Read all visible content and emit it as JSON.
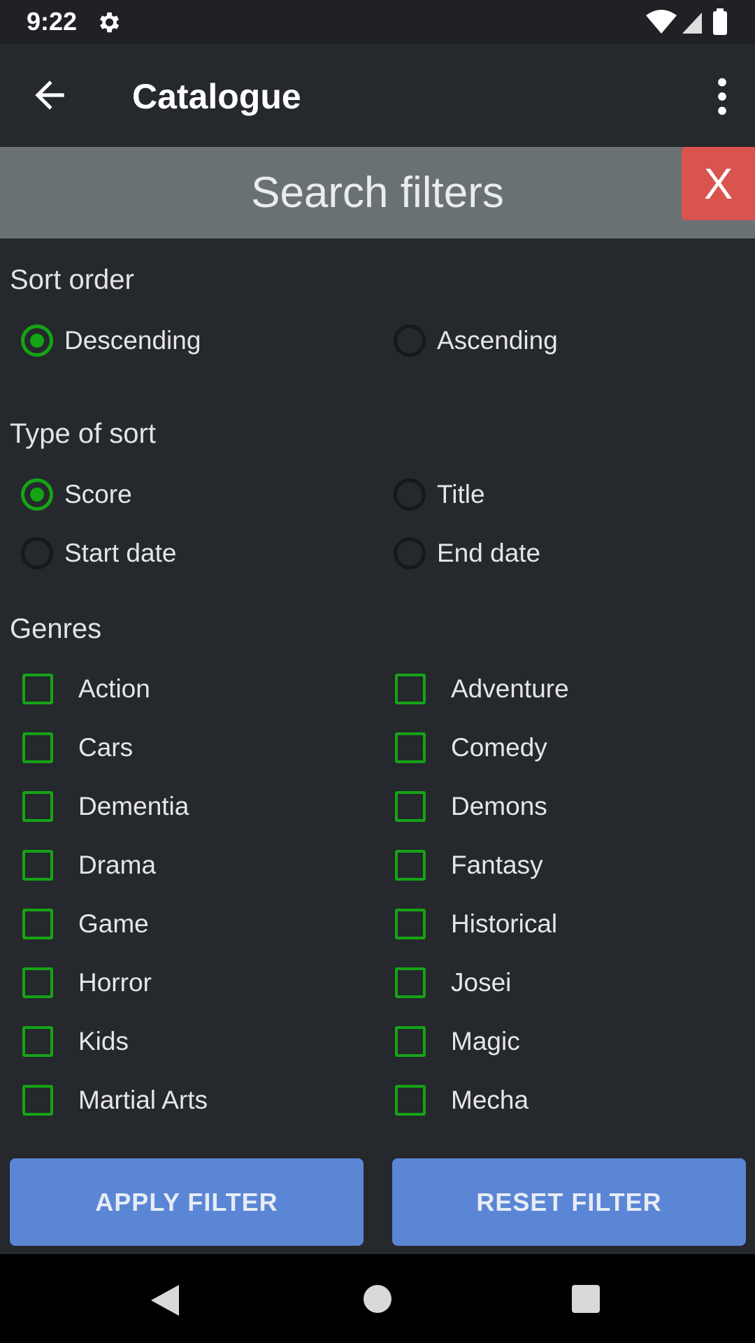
{
  "status_bar": {
    "time": "9:22"
  },
  "app_bar": {
    "title": "Catalogue"
  },
  "filter_panel": {
    "title": "Search filters",
    "close_label": "X",
    "sort_order": {
      "label": "Sort order",
      "options": [
        {
          "label": "Descending",
          "checked": true
        },
        {
          "label": "Ascending",
          "checked": false
        }
      ]
    },
    "sort_type": {
      "label": "Type of sort",
      "options": [
        {
          "label": "Score",
          "checked": true
        },
        {
          "label": "Title",
          "checked": false
        },
        {
          "label": "Start date",
          "checked": false
        },
        {
          "label": "End date",
          "checked": false
        }
      ]
    },
    "genres": {
      "label": "Genres",
      "items": [
        "Action",
        "Adventure",
        "Cars",
        "Comedy",
        "Dementia",
        "Demons",
        "Drama",
        "Fantasy",
        "Game",
        "Historical",
        "Horror",
        "Josei",
        "Kids",
        "Magic",
        "Martial Arts",
        "Mecha"
      ]
    },
    "buttons": {
      "apply": "APPLY FILTER",
      "reset": "RESET FILTER"
    }
  },
  "colors": {
    "accent_green": "#15a316",
    "button_blue": "#5b86d6",
    "close_red": "#d9534f"
  },
  "icons": {
    "back": "arrow-left-icon",
    "menu": "more-vert-icon",
    "settings": "gear-icon"
  }
}
